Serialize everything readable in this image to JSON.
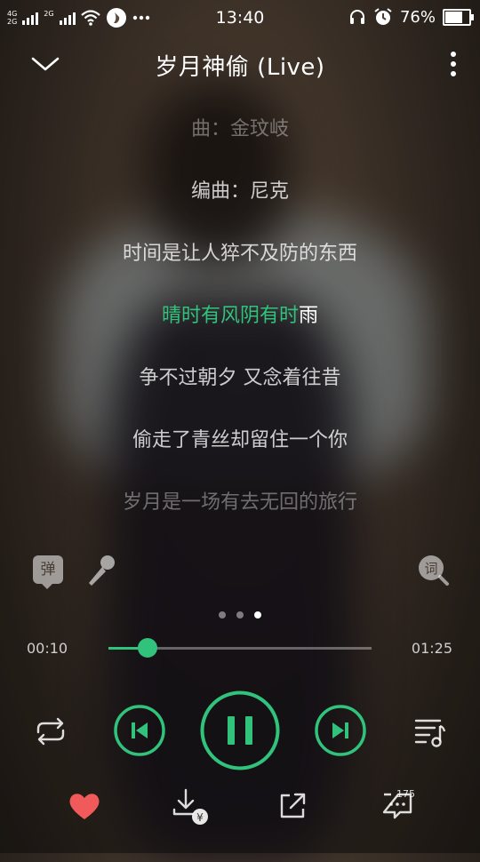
{
  "status_bar": {
    "net_top": "4G",
    "net_bottom": "2G",
    "net_secondary": "2G",
    "time": "13:40",
    "battery_text": "76%",
    "battery_level": 0.76
  },
  "header": {
    "title": "岁月神偷 (Live)"
  },
  "lyrics": [
    {
      "text": "曲：金玟岐",
      "state": "faint"
    },
    {
      "text": "编曲：尼克",
      "state": "normal"
    },
    {
      "text": "时间是让人猝不及防的东西",
      "state": "normal"
    },
    {
      "text_sung": "晴时有风阴有时",
      "text_rest": "雨",
      "state": "active"
    },
    {
      "text": "争不过朝夕 又念着往昔",
      "state": "normal"
    },
    {
      "text": "偷走了青丝却留住一个你",
      "state": "normal"
    },
    {
      "text": "岁月是一场有去无回的旅行",
      "state": "faint"
    }
  ],
  "danmaku_label": "弹",
  "page_indicator": {
    "count": 3,
    "active": 3
  },
  "progress": {
    "current": "00:10",
    "total": "01:25",
    "fraction": 0.15
  },
  "comments": {
    "count": "175"
  },
  "colors": {
    "accent": "#31c27c",
    "like": "#f05a5a"
  },
  "icons": [
    "chevron-down-icon",
    "more-vertical-icon",
    "danmaku-icon",
    "microphone-icon",
    "lyric-search-icon",
    "repeat-icon",
    "previous-icon",
    "pause-icon",
    "next-icon",
    "playlist-icon",
    "heart-icon",
    "download-icon",
    "share-icon",
    "comment-icon"
  ]
}
